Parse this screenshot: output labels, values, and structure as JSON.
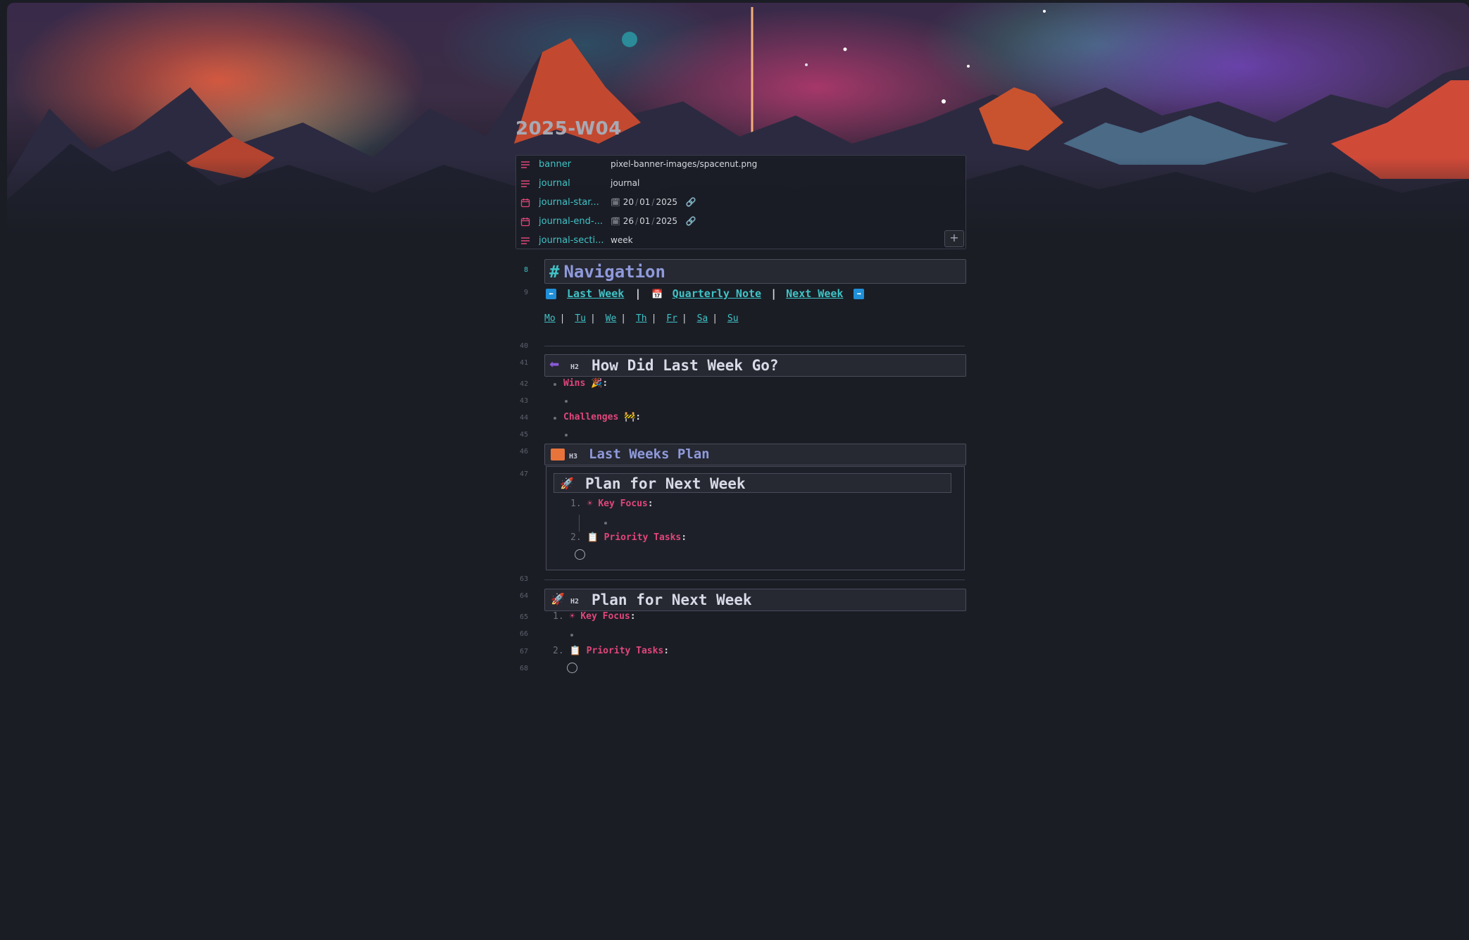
{
  "page": {
    "title": "2025-W04"
  },
  "properties": [
    {
      "key": "banner",
      "value": "pixel-banner-images/spacenut.png",
      "icon": "text-lines-icon"
    },
    {
      "key": "journal",
      "value": "journal",
      "icon": "text-lines-icon"
    },
    {
      "key": "journal-star...",
      "date": {
        "d": "20",
        "m": "01",
        "y": "2025"
      },
      "icon": "calendar-icon"
    },
    {
      "key": "journal-end-...",
      "date": {
        "d": "26",
        "m": "01",
        "y": "2025"
      },
      "icon": "calendar-icon"
    },
    {
      "key": "journal-secti...",
      "value": "week",
      "icon": "text-lines-icon"
    }
  ],
  "line_numbers": {
    "n8": "8",
    "n9": "9",
    "n40": "40",
    "n41": "41",
    "n42": "42",
    "n43": "43",
    "n44": "44",
    "n45": "45",
    "n46": "46",
    "n47": "47",
    "n63": "63",
    "n64": "64",
    "n65": "65",
    "n66": "66",
    "n67": "67",
    "n68": "68"
  },
  "navigation": {
    "heading": "Navigation",
    "last_week": "Last Week",
    "quarterly_note": "Quarterly Note",
    "next_week": "Next Week",
    "pipe": "|",
    "days": [
      "Mo",
      "Tu",
      "We",
      "Th",
      "Fr",
      "Sa",
      "Su"
    ]
  },
  "review": {
    "tag": "H2",
    "heading": "How Did Last Week Go?",
    "wins": "Wins",
    "challenges": "Challenges",
    "colon": ":"
  },
  "last_plan": {
    "tag": "H3",
    "heading": "Last Weeks Plan"
  },
  "embed": {
    "heading": "Plan for Next Week",
    "n1": "1.",
    "n2": "2.",
    "key_focus": "Key Focus",
    "priority_tasks": "Priority Tasks",
    "colon": ":"
  },
  "next_plan": {
    "tag": "H2",
    "heading": "Plan for Next Week",
    "n1": "1.",
    "n2": "2.",
    "key_focus": "Key Focus",
    "priority_tasks": "Priority Tasks",
    "colon": ":"
  },
  "add_property_label": "+",
  "colors": {
    "accent_cyan": "#3fc3c6",
    "accent_pink": "#e0467a",
    "heading_purple": "#8f9adb",
    "background": "#1b1d25"
  }
}
